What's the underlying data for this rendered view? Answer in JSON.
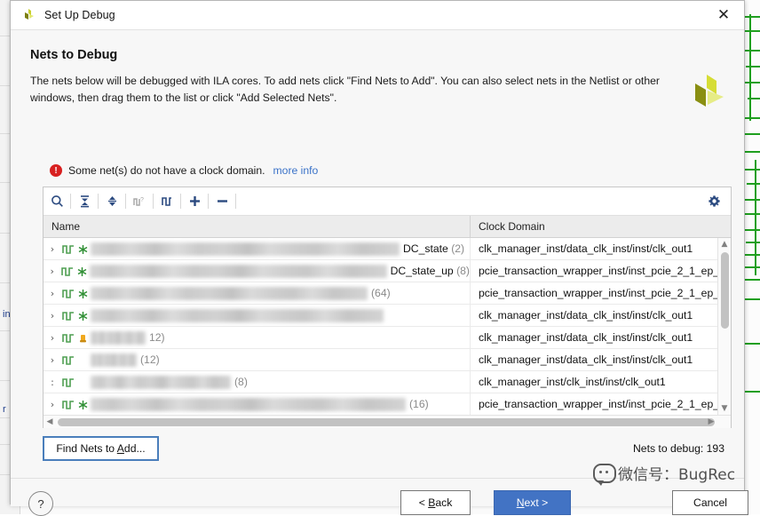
{
  "window": {
    "title": "Set Up Debug",
    "logo_icon": "xilinx-logo-icon",
    "close_icon": "close-icon"
  },
  "page": {
    "title": "Nets to Debug",
    "description": "The nets below will be debugged with ILA cores. To add nets click \"Find Nets to Add\". You can also select nets in the Netlist or other windows, then drag them to the list or click \"Add Selected Nets\".",
    "brand_logo_icon": "xilinx-brand-icon"
  },
  "warning": {
    "icon": "error-exclamation-icon",
    "badge": "!",
    "message": "Some net(s) do not have a clock domain.",
    "link": "more info"
  },
  "toolbar": {
    "buttons": [
      {
        "name": "search-icon",
        "glyph": "search"
      },
      {
        "name": "collapse-all-icon",
        "glyph": "collapse"
      },
      {
        "name": "expand-all-icon",
        "glyph": "expand"
      },
      {
        "name": "unknown-clock-domain-icon",
        "glyph": "netq"
      },
      {
        "name": "clock-domain-icon",
        "glyph": "net"
      },
      {
        "name": "add-nets-icon",
        "glyph": "plus"
      },
      {
        "name": "remove-nets-icon",
        "glyph": "minus"
      }
    ],
    "settings_icon": "gear-icon"
  },
  "table": {
    "columns": [
      "Name",
      "Clock Domain"
    ],
    "rows": [
      {
        "expander": "›",
        "icon": "net-waveform-icon",
        "flag": "green-asterisk",
        "name_redacted": true,
        "redact_width": 348,
        "name_suffix": "DC_state",
        "count": "(2)",
        "clock_domain": "clk_manager_inst/data_clk_inst/inst/clk_out1"
      },
      {
        "expander": "›",
        "icon": "net-waveform-icon",
        "flag": "green-asterisk",
        "name_redacted": true,
        "redact_width": 344,
        "name_suffix": "DC_state_up",
        "count": "(8)",
        "clock_domain": "pcie_transaction_wrapper_inst/inst_pcie_2_1_ep_"
      },
      {
        "expander": "›",
        "icon": "net-waveform-icon",
        "flag": "green-asterisk",
        "name_redacted": true,
        "redact_width": 312,
        "name_suffix": "",
        "count": "(64)",
        "clock_domain": "pcie_transaction_wrapper_inst/inst_pcie_2_1_ep_"
      },
      {
        "expander": "›",
        "icon": "net-waveform-icon",
        "flag": "green-asterisk",
        "name_redacted": true,
        "redact_width": 330,
        "name_suffix": "",
        "count": "",
        "clock_domain": "clk_manager_inst/data_clk_inst/inst/clk_out1"
      },
      {
        "expander": "›",
        "icon": "net-waveform-icon",
        "flag": "orange-warning",
        "name_redacted": true,
        "redact_width": 62,
        "name_suffix": "",
        "count": "12)",
        "clock_domain": "clk_manager_inst/data_clk_inst/inst/clk_out1"
      },
      {
        "expander": "›",
        "icon": "net-waveform-icon",
        "flag": "none",
        "name_redacted": true,
        "redact_width": 52,
        "name_suffix": "",
        "count": "(12)",
        "clock_domain": "clk_manager_inst/data_clk_inst/inst/clk_out1"
      },
      {
        "expander": ":",
        "icon": "net-waveform-icon",
        "flag": "none",
        "name_redacted": true,
        "redact_width": 158,
        "name_suffix": "",
        "count": "(8)",
        "clock_domain": "clk_manager_inst/clk_inst/inst/clk_out1"
      },
      {
        "expander": "›",
        "icon": "net-waveform-icon",
        "flag": "green-asterisk",
        "name_redacted": true,
        "redact_width": 355,
        "name_suffix": "",
        "count": "(16)",
        "clock_domain": "pcie_transaction_wrapper_inst/inst_pcie_2_1_ep_"
      }
    ]
  },
  "controls": {
    "find_nets_label": "Find Nets to Add...",
    "find_nets_mnemonic": "A",
    "nets_to_debug_label": "Nets to debug:",
    "nets_to_debug_count": "193"
  },
  "footer": {
    "help_label": "?",
    "back_label": "< Back",
    "back_mnemonic": "B",
    "next_label": "Next >",
    "next_mnemonic": "N",
    "cancel_label": "Cancel"
  },
  "watermark": {
    "icon": "wechat-bubble-icon",
    "text": "微信号：BugRec"
  },
  "colors": {
    "accent_blue": "#4273c4",
    "link_blue": "#3a72c8",
    "error_red": "#d82020",
    "net_green": "#4f9f52",
    "toolbar_icon": "#2b4a80",
    "brand_yellow": "#d6dd35"
  }
}
